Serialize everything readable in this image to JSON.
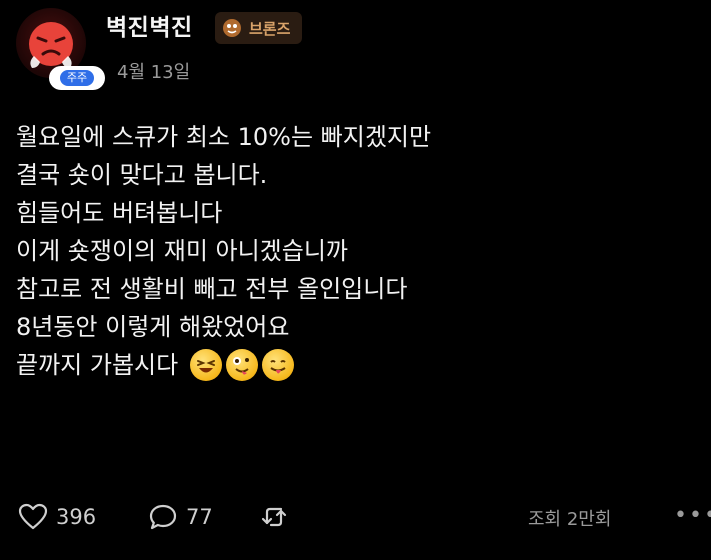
{
  "post": {
    "author": {
      "name": "벽진벽진",
      "team_badge": "주주",
      "rank_badge": "브론즈"
    },
    "date": "4월 13일",
    "lines": [
      "월요일에 스큐가 최소 10%는 빠지겠지만",
      "결국 숏이 맞다고 봅니다.",
      "힘들어도 버텨봅니다",
      "이게 숏쟁이의 재미 아니겠습니까",
      "참고로 전 생활비 빼고 전부 올인입니다",
      "8년동안 이렇게 해왔었어요",
      "끝까지 가봅시다"
    ],
    "emojis": [
      "grinning-squinting-emoji",
      "zany-face-emoji",
      "tongue-face-emoji"
    ],
    "stats": {
      "likes": "396",
      "comments": "77",
      "views": "조회 2만회"
    },
    "icons": {
      "like": "heart-icon",
      "comment": "speech-bubble-icon",
      "repost": "repost-icon",
      "more": "more-icon"
    },
    "colors": {
      "background": "#000000",
      "rank_badge_text": "#d9a36a",
      "team_badge_blue": "#2f6ee8"
    }
  }
}
